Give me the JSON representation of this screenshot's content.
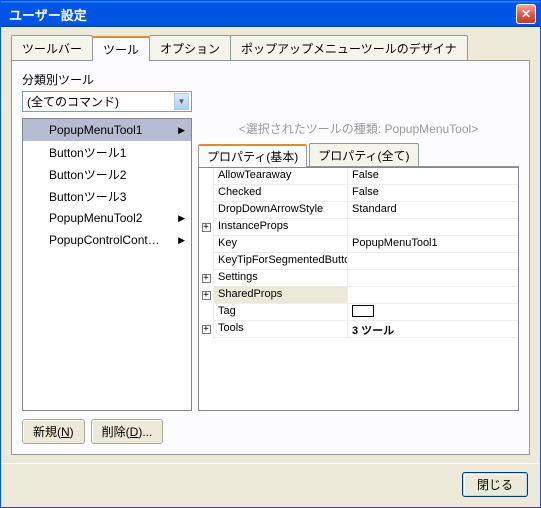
{
  "window": {
    "title": "ユーザー設定"
  },
  "main_tabs": [
    "ツールバー",
    "ツール",
    "オプション",
    "ポップアップメニューツールのデザイナ"
  ],
  "main_tab_active": 1,
  "section": {
    "label": "分類別ツール",
    "dropdown_value": "(全てのコマンド)"
  },
  "tools": [
    {
      "label": "PopupMenuTool1",
      "has_sub": true,
      "selected": true
    },
    {
      "label": "Buttonツール1",
      "has_sub": false
    },
    {
      "label": "Buttonツール2",
      "has_sub": false
    },
    {
      "label": "Buttonツール3",
      "has_sub": false
    },
    {
      "label": "PopupMenuTool2",
      "has_sub": true
    },
    {
      "label": "PopupControlCont…",
      "has_sub": true
    }
  ],
  "type_hint_prefix": "<選択されたツールの種類: ",
  "type_hint_value": "PopupMenuTool",
  "type_hint_suffix": ">",
  "inner_tabs": [
    "プロパティ(基本)",
    "プロパティ(全て)"
  ],
  "inner_tab_active": 0,
  "props": [
    {
      "name": "AllowTearaway",
      "value": "False",
      "expand": false
    },
    {
      "name": "Checked",
      "value": "False",
      "expand": false
    },
    {
      "name": "DropDownArrowStyle",
      "value": "Standard",
      "expand": false
    },
    {
      "name": "InstanceProps",
      "value": "",
      "expand": true
    },
    {
      "name": "Key",
      "value": "PopupMenuTool1",
      "expand": false
    },
    {
      "name": "KeyTipForSegmentedButto",
      "value": "",
      "expand": false
    },
    {
      "name": "Settings",
      "value": "",
      "expand": true
    },
    {
      "name": "SharedProps",
      "value": "",
      "expand": true,
      "selected": true
    },
    {
      "name": "Tag",
      "value": "__BOX__",
      "expand": false
    },
    {
      "name": "Tools",
      "value": "3 ツール",
      "expand": true,
      "bold": true
    }
  ],
  "buttons": {
    "new": "新規",
    "new_key": "N",
    "delete": "削除",
    "delete_key": "D",
    "close": "閉じる"
  }
}
